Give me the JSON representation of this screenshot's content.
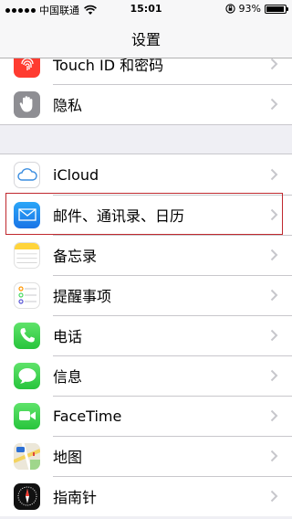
{
  "status_bar": {
    "carrier": "中国联通",
    "time": "15:01",
    "battery": "93%",
    "battery_level": 0.93
  },
  "nav": {
    "title": "设置"
  },
  "group1": [
    {
      "label": "Touch ID 和密码",
      "icon": "fingerprint-icon",
      "color": "#ff3b30"
    },
    {
      "label": "隐私",
      "icon": "hand-icon",
      "color": "#8e8e93"
    }
  ],
  "group2": [
    {
      "label": "iCloud",
      "icon": "cloud-icon",
      "color": "#ffffff"
    },
    {
      "label": "邮件、通讯录、日历",
      "icon": "mail-icon",
      "color": "#1a8cf0"
    },
    {
      "label": "备忘录",
      "icon": "notes-icon",
      "color": "#ffd43b"
    },
    {
      "label": "提醒事项",
      "icon": "reminders-icon",
      "color": "#ffffff"
    },
    {
      "label": "电话",
      "icon": "phone-icon",
      "color": "#4cd964"
    },
    {
      "label": "信息",
      "icon": "messages-icon",
      "color": "#4cd964"
    },
    {
      "label": "FaceTime",
      "icon": "facetime-icon",
      "color": "#4cd964"
    },
    {
      "label": "地图",
      "icon": "maps-icon",
      "color": "#e9e4d6"
    },
    {
      "label": "指南针",
      "icon": "compass-icon",
      "color": "#111111"
    }
  ]
}
